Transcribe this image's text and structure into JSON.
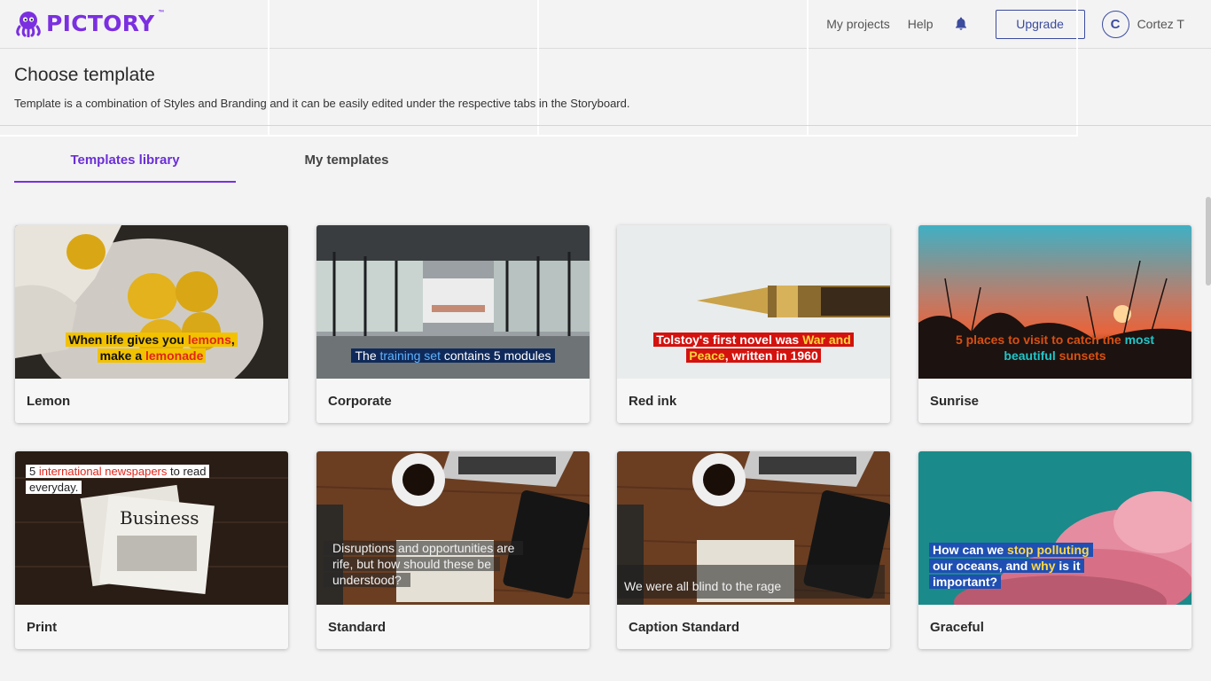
{
  "brand": {
    "name": "PICTORY",
    "tm": "™",
    "color": "#7b2fe0"
  },
  "header": {
    "nav": [
      "My projects",
      "Help"
    ],
    "upgrade_label": "Upgrade",
    "avatar_initial": "C",
    "user_name": "Cortez T"
  },
  "page": {
    "title": "Choose template",
    "description": "Template is a combination of Styles and Branding and it can be easily edited under the respective tabs in the Storyboard."
  },
  "tabs": [
    {
      "label": "Templates library",
      "active": true
    },
    {
      "label": "My templates",
      "active": false
    }
  ],
  "templates": [
    {
      "name": "Lemon",
      "caption": [
        "When life gives you ",
        "lemons",
        ",",
        "make a ",
        "lemonade"
      ]
    },
    {
      "name": "Corporate",
      "caption": [
        "The ",
        "training set",
        " contains 5 modules"
      ]
    },
    {
      "name": "Red ink",
      "caption": [
        "Tolstoy's first novel was ",
        "War and",
        "Peace",
        ", written in 1960"
      ]
    },
    {
      "name": "Sunrise",
      "caption": [
        "5 places to visit to catch the ",
        "most",
        "beautiful",
        " sunsets"
      ]
    },
    {
      "name": "Print",
      "caption": [
        "5 ",
        "international newspapers",
        " to read",
        "everyday."
      ]
    },
    {
      "name": "Standard",
      "caption": [
        "Disruptions and opportunities are",
        "rife, but how should these be",
        "understood?"
      ]
    },
    {
      "name": "Caption Standard",
      "caption": [
        "We were all blind to the rage"
      ]
    },
    {
      "name": "Graceful",
      "caption": [
        "How can we ",
        "stop polluting",
        "our oceans, and ",
        "why",
        " is it",
        "important?"
      ]
    }
  ],
  "colors": {
    "accent": "#7b2fe0",
    "navy": "#3b4b9e"
  }
}
